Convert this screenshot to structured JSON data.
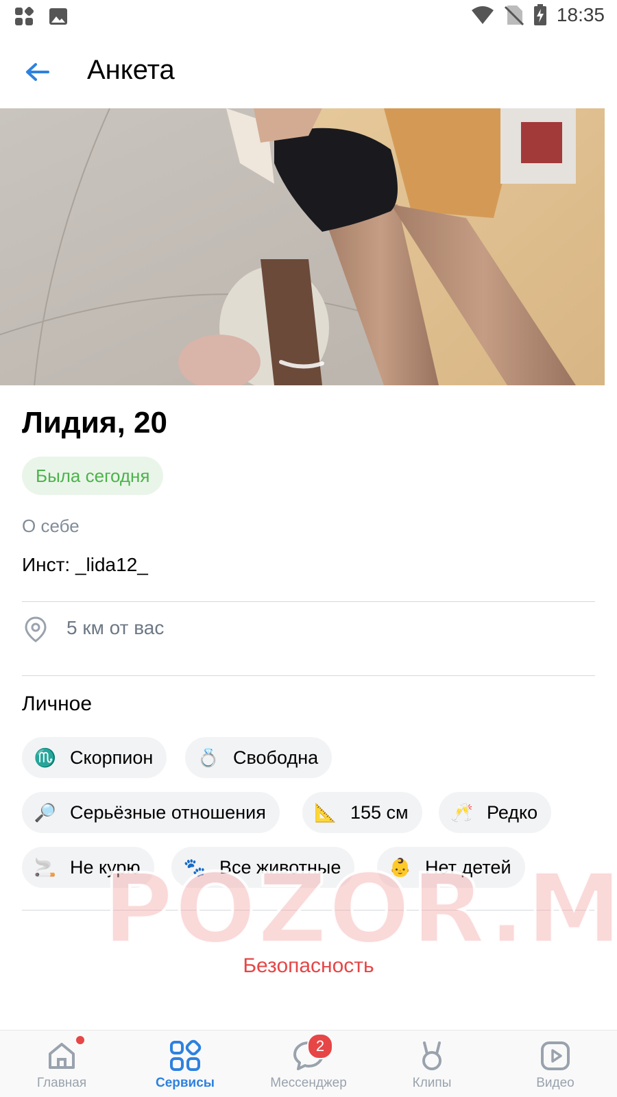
{
  "status_bar": {
    "time": "18:35",
    "icons": [
      "apps-icon",
      "image-icon",
      "wifi-icon",
      "no-sim-icon",
      "battery-charging-icon"
    ]
  },
  "header": {
    "title": "Анкета",
    "back_icon": "arrow-left-icon"
  },
  "profile": {
    "name_age": "Лидия, 20",
    "last_seen": "Была сегодня",
    "about_label": "О себе",
    "about_text": "Инст: _lida12_",
    "distance": "5 км от вас"
  },
  "personal": {
    "title": "Личное",
    "chips": [
      {
        "emoji": "♏",
        "label": "Скорпион"
      },
      {
        "emoji": "💍",
        "label": "Свободна"
      },
      {
        "emoji": "🔎",
        "label": "Серьёзные отношения"
      },
      {
        "emoji": "📐",
        "label": "155 см"
      },
      {
        "emoji": "🥂",
        "label": "Редко"
      },
      {
        "emoji": "🚬",
        "label": "Не курю"
      },
      {
        "emoji": "🐾",
        "label": "Все животные"
      },
      {
        "emoji": "👶",
        "label": "Нет детей"
      }
    ]
  },
  "safety_link": "Безопасность",
  "watermark": "POZOR.ME",
  "tabbar": {
    "items": [
      {
        "label": "Главная",
        "icon": "home-icon",
        "active": false,
        "dot": true
      },
      {
        "label": "Сервисы",
        "icon": "services-icon",
        "active": true
      },
      {
        "label": "Мессенджер",
        "icon": "messenger-icon",
        "active": false,
        "badge": "2"
      },
      {
        "label": "Клипы",
        "icon": "clips-icon",
        "active": false
      },
      {
        "label": "Видео",
        "icon": "video-icon",
        "active": false
      }
    ]
  },
  "colors": {
    "accent": "#2d81e0",
    "online_green": "#4bb34b",
    "danger_red": "#e64646",
    "chip_bg": "#f2f3f5",
    "secondary_text": "#818c99"
  }
}
